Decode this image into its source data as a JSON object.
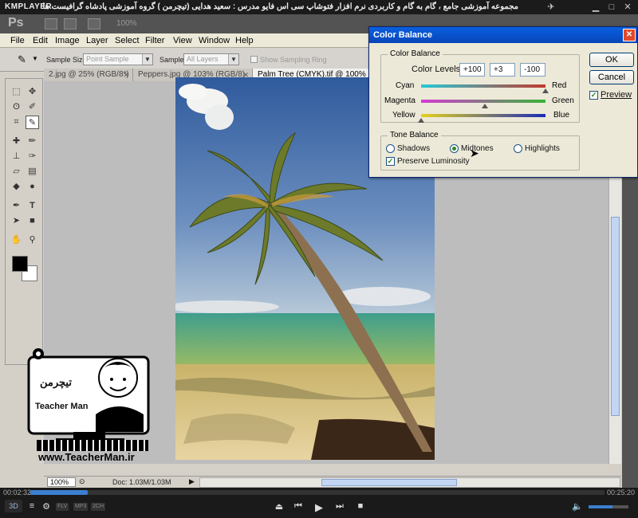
{
  "player": {
    "logo": "KMPLAYER",
    "caption": "مجموعه آموزشی جامع ، گام به گام و کاربردی نرم افزار فتوشاپ سی اس فایو   مدرس : سعید هدایی (تیچرمن ) گروه آموزشی پادشاه گرافیست ها",
    "time_current": "00:02:32",
    "time_total": "00:25:20",
    "progress": 0.1,
    "volume": 0.6,
    "tags": [
      "FLV",
      "MP3",
      "2CH"
    ],
    "mode_3d": "3D"
  },
  "photoshop": {
    "logo": "Ps",
    "zoom_top": "100%",
    "menu": [
      "File",
      "Edit",
      "Image",
      "Layer",
      "Select",
      "Filter",
      "View",
      "Window",
      "Help"
    ],
    "options": {
      "sample_size_label": "Sample Size:",
      "sample_size_value": "Point Sample",
      "sample_label": "Sample:",
      "sample_value": "All Layers",
      "show_ring_label": "Show Sampling Ring"
    },
    "tabs": [
      {
        "label": "2.jpg @ 25% (RGB/8*)"
      },
      {
        "label": "Peppers.jpg @ 103% (RGB/8)"
      },
      {
        "label": "Palm Tree (CMYK).tif @ 100%"
      }
    ],
    "status": {
      "zoom": "100%",
      "doc": "Doc: 1.03M/1.03M"
    }
  },
  "dialog": {
    "title": "Color Balance",
    "color_balance_legend": "Color Balance",
    "color_levels_label": "Color Levels:",
    "levels": [
      "+100",
      "+3",
      "-100"
    ],
    "sliders": [
      {
        "left": "Cyan",
        "right": "Red",
        "value": 100
      },
      {
        "left": "Magenta",
        "right": "Green",
        "value": 3
      },
      {
        "left": "Yellow",
        "right": "Blue",
        "value": -100
      }
    ],
    "tone_legend": "Tone Balance",
    "tones": [
      "Shadows",
      "Midtones",
      "Highlights"
    ],
    "tone_selected": "Midtones",
    "preserve_label": "Preserve Luminosity",
    "ok": "OK",
    "cancel": "Cancel",
    "preview": "Preview"
  },
  "watermark": {
    "url": "www.TeacherMan.ir",
    "brand": "Teacher Man",
    "brand_fa": "تیچرمن"
  }
}
